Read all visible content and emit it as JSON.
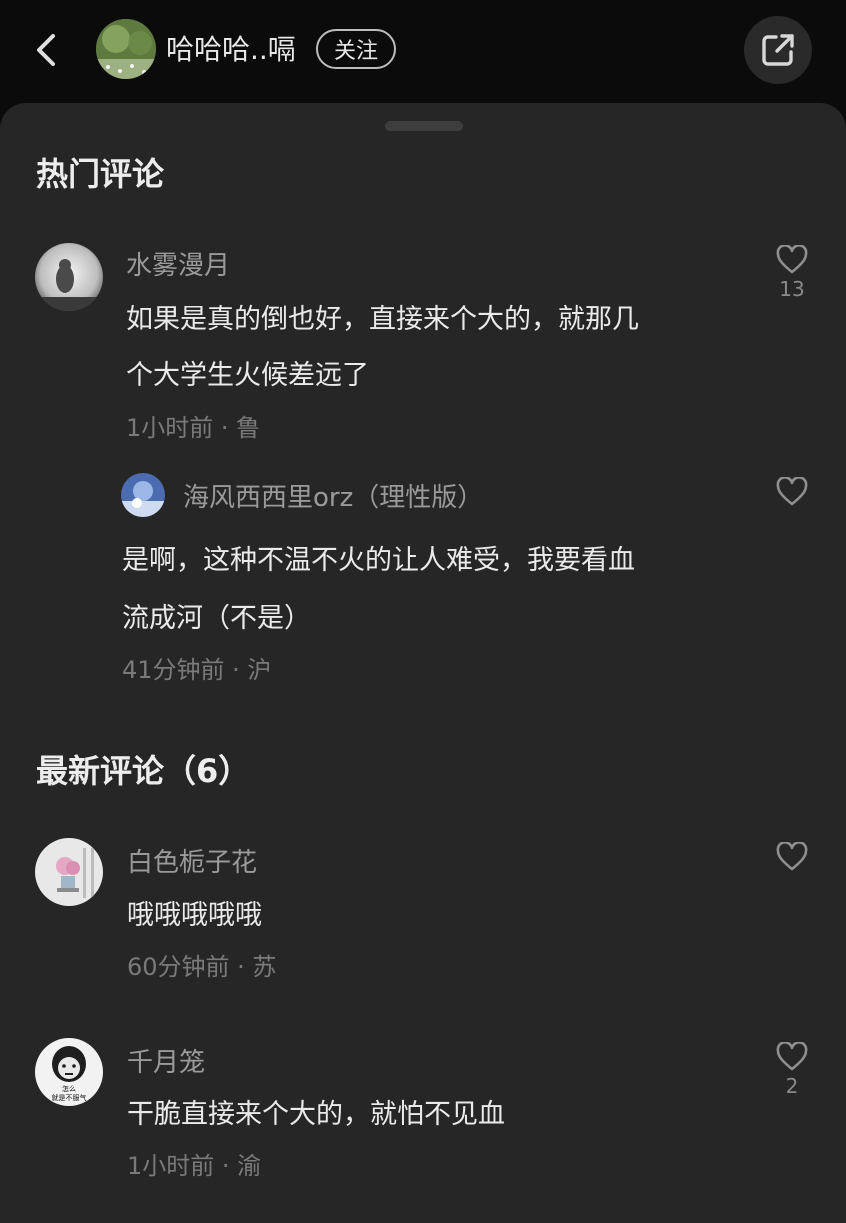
{
  "header": {
    "author_name": "哈哈哈..嗝",
    "follow_label": "关注"
  },
  "hot": {
    "title": "热门评论",
    "comments": [
      {
        "user": "水雾漫月",
        "lines": [
          "如果是真的倒也好，直接来个大的，就那几",
          "个大学生火候差远了"
        ],
        "meta": "1小时前 · 鲁",
        "likes": "13",
        "reply": {
          "user": "海风西西里orz（理性版）",
          "lines": [
            "是啊，这种不温不火的让人难受，我要看血",
            "流成河（不是）"
          ],
          "meta": "41分钟前 · 沪"
        }
      }
    ]
  },
  "latest": {
    "title": "最新评论（6）",
    "comments": [
      {
        "user": "白色栀子花",
        "lines": [
          "哦哦哦哦哦"
        ],
        "meta": "60分钟前 · 苏",
        "likes": ""
      },
      {
        "user": "千月笼",
        "avatar_caption": [
          "怎么",
          "就是不服气"
        ],
        "lines": [
          "干脆直接来个大的，就怕不见血"
        ],
        "meta": "1小时前 · 渝",
        "likes": "2"
      }
    ]
  },
  "icons": {
    "back": "chevron-left-icon",
    "share": "share-icon",
    "like": "heart-outline-icon"
  }
}
